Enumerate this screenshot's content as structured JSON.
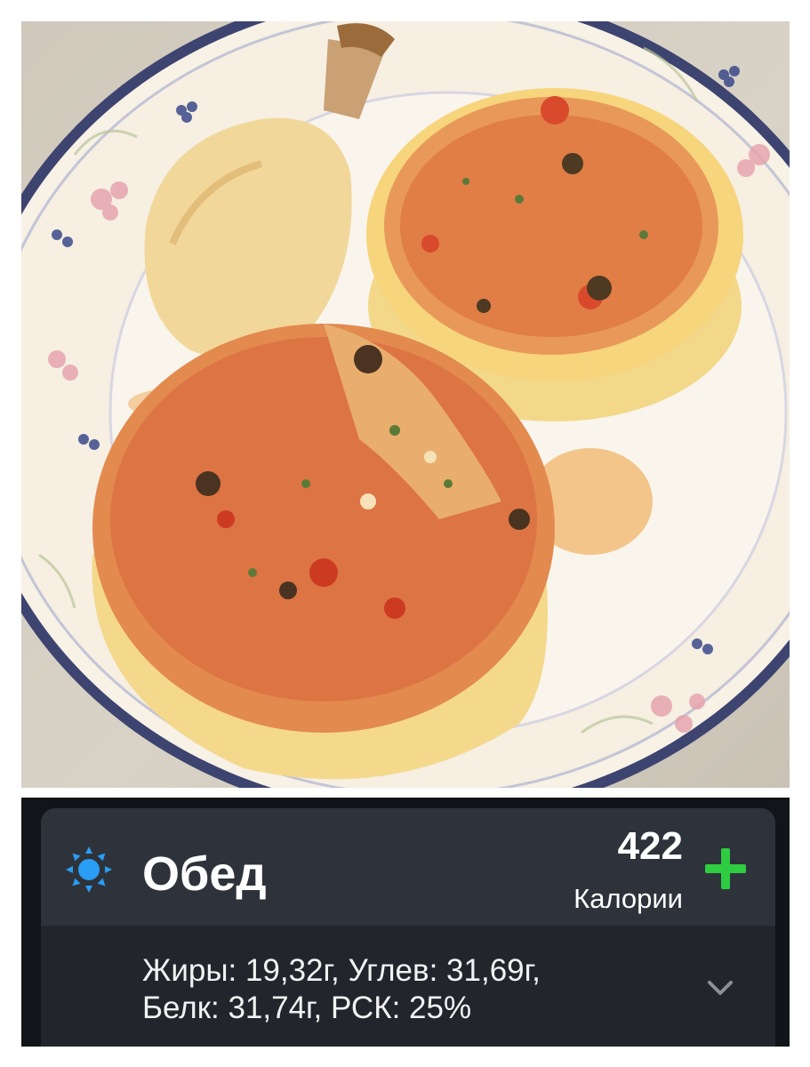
{
  "meal": {
    "title": "Обед",
    "icon": "sun-icon",
    "calories_value": "422",
    "calories_label": "Калории",
    "add_icon": "plus-icon",
    "macros_line1": "Жиры: 19,32г, Углев: 31,69г,",
    "macros_line2": "Белк: 31,74г, РСК: 25%",
    "expand_icon": "chevron-down-icon"
  },
  "colors": {
    "sun": "#2a9df4",
    "add": "#2ecc40",
    "card_header": "#2e333b",
    "card_body": "#22262c",
    "background": "#111418"
  },
  "photo": {
    "subject": "stuffed-vegetables-with-chicken-on-plate"
  }
}
